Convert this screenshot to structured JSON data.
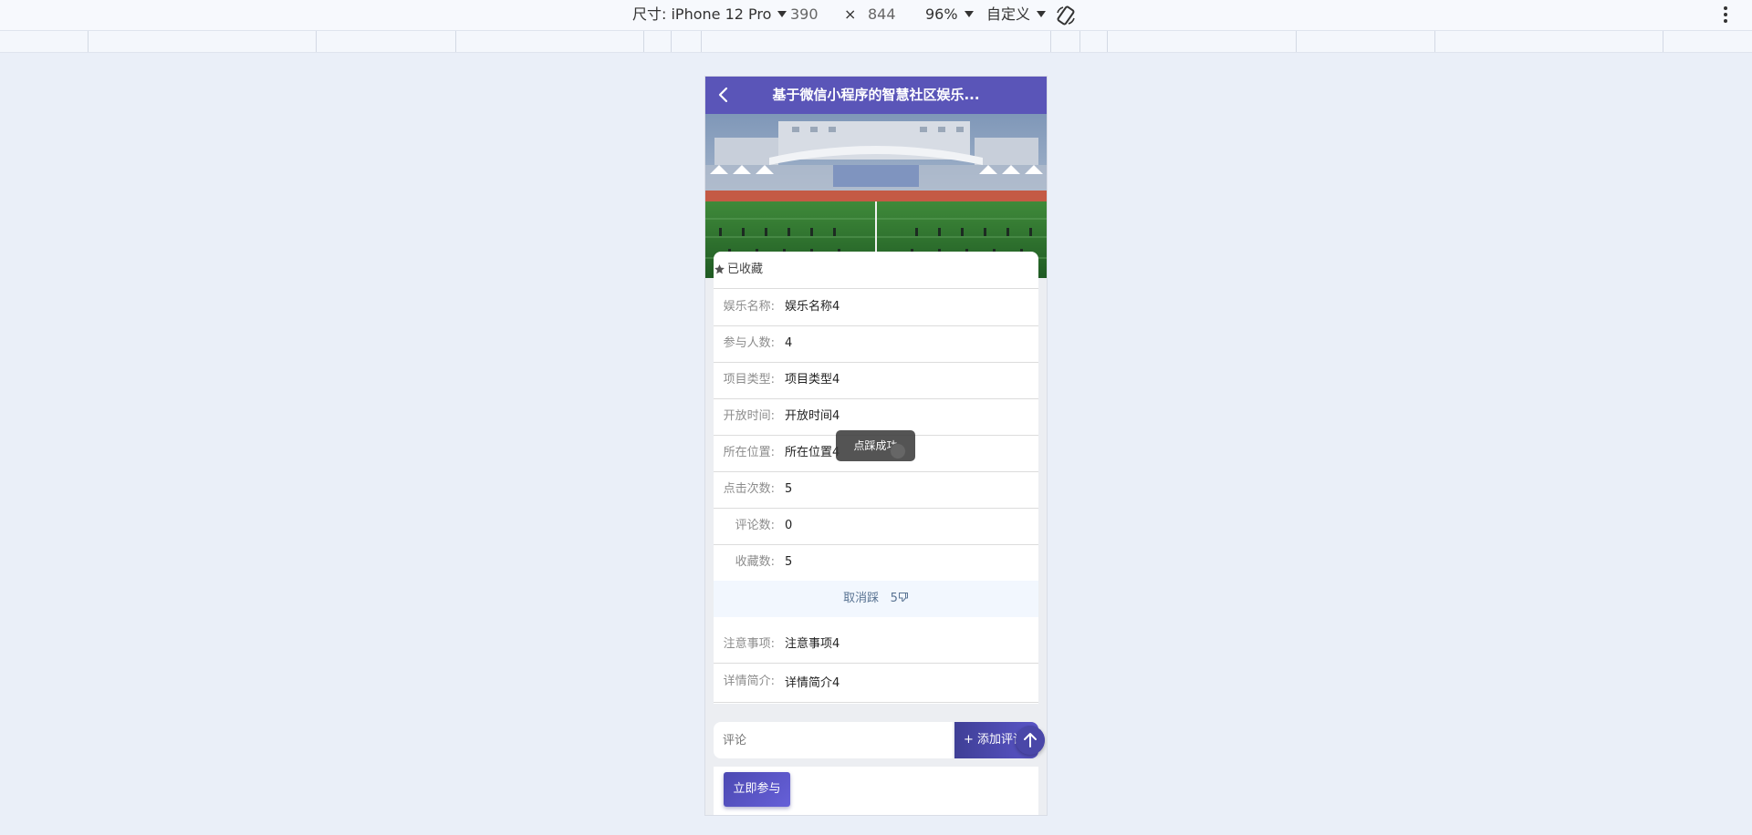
{
  "devtools": {
    "size_label": "尺寸: iPhone 12 Pro",
    "width": "390",
    "times": "×",
    "height": "844",
    "zoom": "96%",
    "throttle": "自定义"
  },
  "app": {
    "title": "基于微信小程序的智慧社区娱乐...",
    "favorite_label": "已收藏",
    "fields": [
      {
        "label": "娱乐名称:",
        "value": "娱乐名称4"
      },
      {
        "label": "参与人数:",
        "value": "4"
      },
      {
        "label": "项目类型:",
        "value": "项目类型4"
      },
      {
        "label": "开放时间:",
        "value": "开放时间4"
      },
      {
        "label": "所在位置:",
        "value": "所在位置4"
      },
      {
        "label": "点击次数:",
        "value": "5"
      },
      {
        "label": "评论数:",
        "value": "0"
      },
      {
        "label": "收藏数:",
        "value": "5"
      }
    ],
    "unlike_label": "取消踩",
    "dislike_count": "5",
    "extra_fields": [
      {
        "label": "注意事项:",
        "value": "注意事项4"
      },
      {
        "label": "详情简介:",
        "value": "详情简介4"
      }
    ],
    "toast": "点踩成功",
    "comment_placeholder": "评论",
    "add_comment_label": "+ 添加评论",
    "join_label": "立即参与"
  },
  "colors": {
    "nav": "#5a55b8",
    "page_bg": "#eaeff8",
    "like_bg": "#f2f7fe"
  }
}
